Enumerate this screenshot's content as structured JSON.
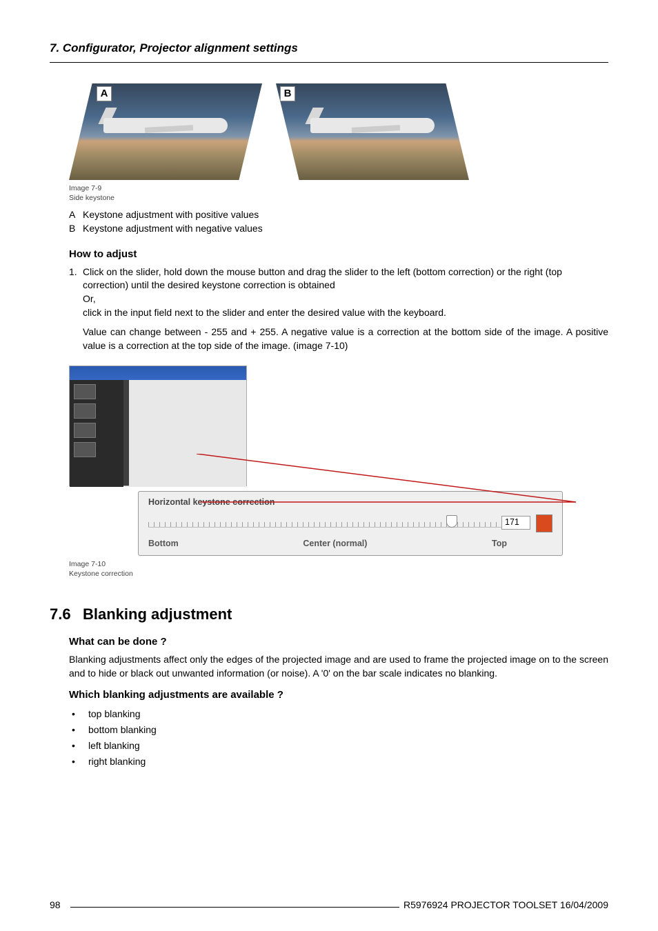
{
  "header": "7. Configurator, Projector alignment settings",
  "imgA": {
    "label": "A"
  },
  "imgB": {
    "label": "B"
  },
  "img79": {
    "num": "Image 7-9",
    "desc": "Side keystone"
  },
  "legend": [
    {
      "k": "A",
      "v": "Keystone adjustment with positive values"
    },
    {
      "k": "B",
      "v": "Keystone adjustment with negative values"
    }
  ],
  "howto": "How to adjust",
  "step1": {
    "n": "1.",
    "t": "Click on the slider, hold down the mouse button and drag the slider to the left (bottom correction) or the right (top correction) until the desired keystone correction is obtained",
    "or": "Or,",
    "t2": "click in the input field next to the slider and enter the desired value with the keyboard."
  },
  "paraValue": "Value can change between - 255 and + 255. A negative value is a correction at the bottom side of the image. A positive value is a correction at the top side of the image. (image 7-10)",
  "slider": {
    "title": "Horizontal keystone correction",
    "bottom": "Bottom",
    "center": "Center (normal)",
    "top": "Top",
    "value": "171"
  },
  "img710": {
    "num": "Image 7-10",
    "desc": "Keystone correction"
  },
  "section": {
    "num": "7.6",
    "title": "Blanking adjustment"
  },
  "whatcan": "What can be done ?",
  "blankingPara": "Blanking adjustments affect only the edges of the projected image and are used to frame the projected image on to the screen and to hide or black out unwanted information (or noise). A '0' on the bar scale indicates no blanking.",
  "which": "Which blanking adjustments are available ?",
  "bullets": [
    "top blanking",
    "bottom blanking",
    "left blanking",
    "right blanking"
  ],
  "footer": {
    "page": "98",
    "text": "R5976924  PROJECTOR TOOLSET  16/04/2009"
  }
}
